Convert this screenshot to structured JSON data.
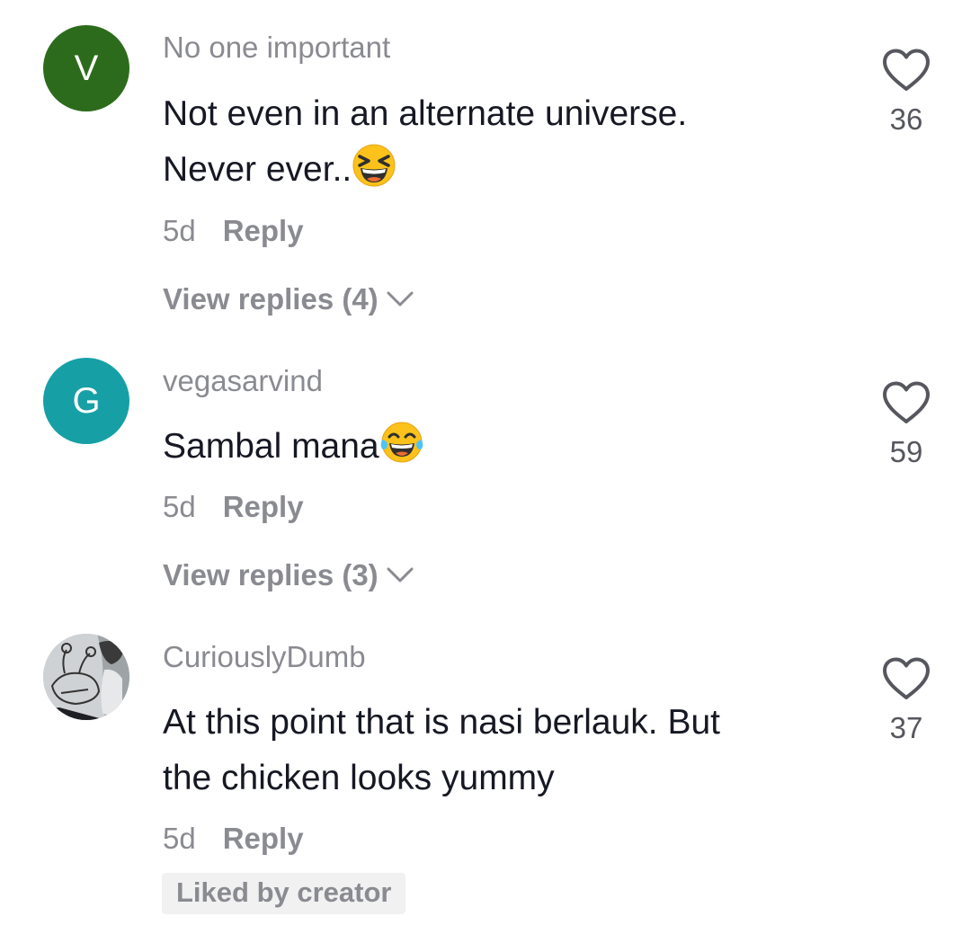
{
  "comments": [
    {
      "avatar_letter": "V",
      "avatar_color": "#2d6b1c",
      "username": "No one important",
      "text_line1": "Not even in an alternate universe.",
      "text_line2": "Never ever..",
      "emoji": "grinning-squinting-face-emoji",
      "time": "5d",
      "reply_label": "Reply",
      "view_replies": "View replies (4)",
      "likes": "36"
    },
    {
      "avatar_letter": "G",
      "avatar_color": "#16a0a6",
      "username": "vegasarvind",
      "text_line1": "Sambal mana",
      "emoji": "tears-of-joy-emoji",
      "time": "5d",
      "reply_label": "Reply",
      "view_replies": "View replies (3)",
      "likes": "59"
    },
    {
      "avatar": "sketch-photo-avatar",
      "username": "CuriouslyDumb",
      "text_line1": "At this point that is nasi berlauk. But",
      "text_line2": "the chicken looks yummy",
      "time": "5d",
      "reply_label": "Reply",
      "badge": "Liked by creator",
      "likes": "37"
    }
  ]
}
